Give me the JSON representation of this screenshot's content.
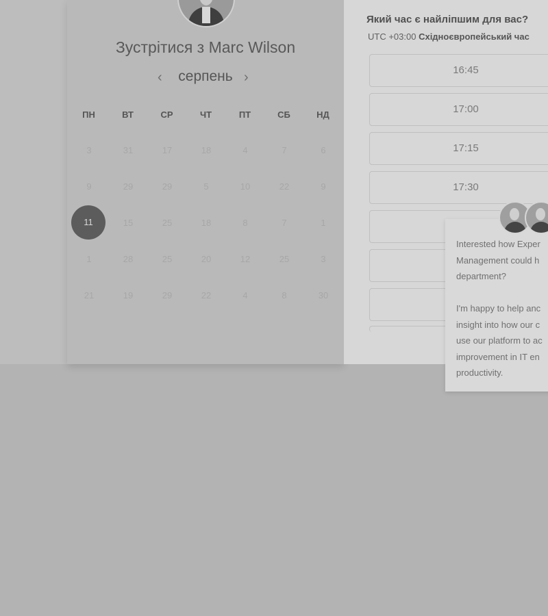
{
  "calendar": {
    "title": "Зустрітися з Marc Wilson",
    "month": "серпень",
    "prev_icon": "‹",
    "next_icon": "›",
    "weekdays": [
      "ПН",
      "ВТ",
      "СР",
      "ЧТ",
      "ПТ",
      "СБ",
      "НД"
    ],
    "weeks": [
      [
        "3",
        "31",
        "17",
        "18",
        "4",
        "7",
        "6"
      ],
      [
        "9",
        "29",
        "29",
        "5",
        "10",
        "22",
        "9"
      ],
      [
        "11",
        "15",
        "25",
        "18",
        "8",
        "7",
        "1"
      ],
      [
        "1",
        "28",
        "25",
        "20",
        "12",
        "25",
        "3"
      ],
      [
        "21",
        "19",
        "29",
        "22",
        "4",
        "8",
        "30"
      ]
    ],
    "selected_day": "11"
  },
  "times": {
    "question": "Який час є найліпшим для вас?",
    "tz_offset": "UTC +03:00",
    "tz_name": "Східноєвропейський час",
    "slots": [
      "16:45",
      "17:00",
      "17:15",
      "17:30",
      "",
      "",
      ""
    ]
  },
  "chat": {
    "message": "Interested how Exper\nManagement could h\ndepartment?\n\nI'm happy to help anc\ninsight into how our c\nuse our platform to ac\nimprovement in IT en\nproductivity."
  }
}
